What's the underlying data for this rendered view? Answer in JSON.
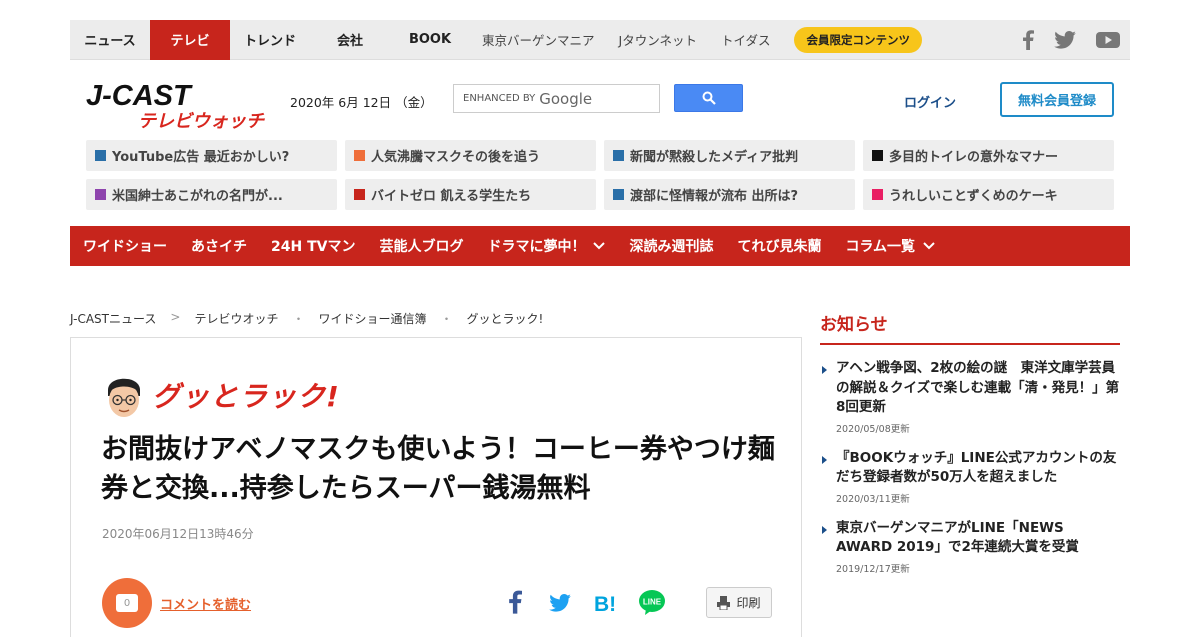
{
  "topnav": {
    "items": [
      {
        "label": "ニュース",
        "active": false
      },
      {
        "label": "テレビ",
        "active": true
      },
      {
        "label": "トレンド",
        "active": false
      },
      {
        "label": "会社",
        "active": false
      },
      {
        "label": "BOOK",
        "active": false
      }
    ],
    "sub_items": [
      "東京バーゲンマニア",
      "Jタウンネット",
      "トイダス"
    ],
    "member_label": "会員限定コンテンツ",
    "social_icons": [
      "facebook-icon",
      "twitter-icon",
      "youtube-icon"
    ]
  },
  "header": {
    "logo_top": "J-CAST",
    "logo_bottom": "テレビウォッチ",
    "date": "2020年 6月 12日 （金）",
    "search_enhanced": "ENHANCED BY",
    "search_brand": "Google",
    "login": "ログイン",
    "register": "無料会員登録"
  },
  "topics": [
    {
      "label": "YouTube広告 最近おかしい?",
      "color": "#2a6fa8"
    },
    {
      "label": "人気沸騰マスクその後を追う",
      "color": "#ef6e3a"
    },
    {
      "label": "新聞が黙殺したメディア批判",
      "color": "#2a6fa8"
    },
    {
      "label": "多目的トイレの意外なマナー",
      "color": "#111111"
    },
    {
      "label": "米国紳士あこがれの名門が...",
      "color": "#8e44ad"
    },
    {
      "label": "バイトゼロ 飢える学生たち",
      "color": "#c7251c"
    },
    {
      "label": "渡部に怪情報が流布 出所は?",
      "color": "#2a6fa8"
    },
    {
      "label": "うれしいことずくめのケーキ",
      "color": "#e91e63"
    }
  ],
  "redmenu": [
    {
      "label": "ワイドショー",
      "dropdown": false
    },
    {
      "label": "あさイチ",
      "dropdown": false
    },
    {
      "label": "24H TVマン",
      "dropdown": false
    },
    {
      "label": "芸能人ブログ",
      "dropdown": false
    },
    {
      "label": "ドラマに夢中！",
      "dropdown": true
    },
    {
      "label": "深読み週刊誌",
      "dropdown": false
    },
    {
      "label": "てれび見朱蘭",
      "dropdown": false
    },
    {
      "label": "コラム一覧",
      "dropdown": true
    }
  ],
  "breadcrumb": [
    "J-CASTニュース",
    "テレビウオッチ",
    "ワイドショー通信簿",
    "グッとラック!"
  ],
  "breadcrumb_seps": [
    ">",
    "・",
    "・"
  ],
  "article": {
    "program": "グッとラック!",
    "headline": "お間抜けアベノマスクも使いよう！コーヒー券やつけ麺券と交換...持参したらスーパー銭湯無料",
    "published": "2020年06月12日13時46分",
    "comment_count": "0",
    "comment_link": "コメントを読む",
    "print": "印刷",
    "share_hatena": "B!",
    "share_line": "LINE"
  },
  "sidebar": {
    "title": "お知らせ",
    "news": [
      {
        "title": "アヘン戦争図、2枚の絵の謎　東洋文庫学芸員の解説＆クイズで楽しむ連載「清・発見！」第8回更新",
        "date": "2020/05/08更新"
      },
      {
        "title": "『BOOKウォッチ』LINE公式アカウントの友だち登録者数が50万人を超えました",
        "date": "2020/03/11更新"
      },
      {
        "title": "東京バーゲンマニアがLINE「NEWS AWARD 2019」で2年連続大賞を受賞",
        "date": "2019/12/17更新"
      }
    ]
  }
}
